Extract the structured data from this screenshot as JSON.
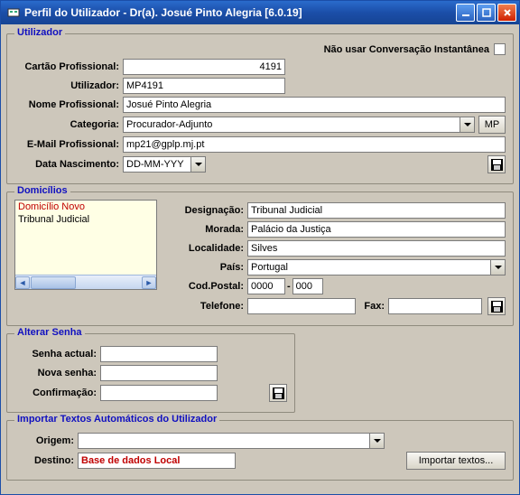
{
  "window": {
    "title": "Perfil do Utilizador - Dr(a). Josué Pinto Alegria [6.0.19]"
  },
  "utilizador_group": {
    "legend": "Utilizador",
    "instant_msg_label": "Não usar Conversação Instantânea",
    "cartao_label": "Cartão Profissional:",
    "cartao_value": "4191",
    "utilizador_label": "Utilizador:",
    "utilizador_value": "MP4191",
    "nome_label": "Nome Profissional:",
    "nome_value": "Josué Pinto Alegria",
    "categoria_label": "Categoria:",
    "categoria_value": "Procurador-Adjunto",
    "mp_btn": "MP",
    "email_label": "E-Mail Profissional:",
    "email_value": "mp21@gplp.mj.pt",
    "data_nasc_label": "Data Nascimento:",
    "data_nasc_value": "DD-MM-YYY"
  },
  "domicilios_group": {
    "legend": "Domicílios",
    "list": {
      "new_item": "Domicílio Novo",
      "item1": "Tribunal Judicial"
    },
    "designacao_label": "Designação:",
    "designacao_value": "Tribunal Judicial",
    "morada_label": "Morada:",
    "morada_value": "Palácio da Justiça",
    "localidade_label": "Localidade:",
    "localidade_value": "Silves",
    "pais_label": "País:",
    "pais_value": "Portugal",
    "codpostal_label": "Cod.Postal:",
    "codpostal_p1": "0000",
    "codpostal_p2": "000",
    "telefone_label": "Telefone:",
    "fax_label": "Fax:"
  },
  "senha_group": {
    "legend": "Alterar Senha",
    "actual_label": "Senha actual:",
    "nova_label": "Nova senha:",
    "confirm_label": "Confirmação:"
  },
  "importar_group": {
    "legend": "Importar Textos Automáticos do Utilizador",
    "origem_label": "Origem:",
    "destino_label": "Destino:",
    "destino_value": "Base de dados Local",
    "importar_btn": "Importar textos..."
  }
}
